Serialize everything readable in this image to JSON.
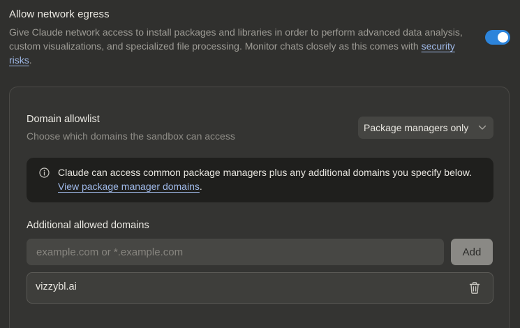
{
  "network": {
    "title": "Allow network egress",
    "description_prefix": "Give Claude network access to install packages and libraries in order to perform advanced data analysis, custom visualizations, and specialized file processing. Monitor chats closely as this comes with ",
    "risk_link": "security risks",
    "description_suffix": ".",
    "toggle_on": true,
    "toggle_color": "#2c84db"
  },
  "allowlist": {
    "title": "Domain allowlist",
    "subtitle": "Choose which domains the sandbox can access",
    "dropdown_value": "Package managers only",
    "dropdown_icon": "chevron-down-icon",
    "info_icon": "info-icon",
    "info_text": "Claude can access common package managers plus any additional domains you specify below. ",
    "info_link": "View package manager domains",
    "info_suffix": "."
  },
  "additional": {
    "title": "Additional allowed domains",
    "placeholder": "example.com or *.example.com",
    "input_value": "",
    "add_label": "Add",
    "domains": [
      {
        "name": "vizzybl.ai",
        "icon": "trash-icon"
      }
    ]
  }
}
